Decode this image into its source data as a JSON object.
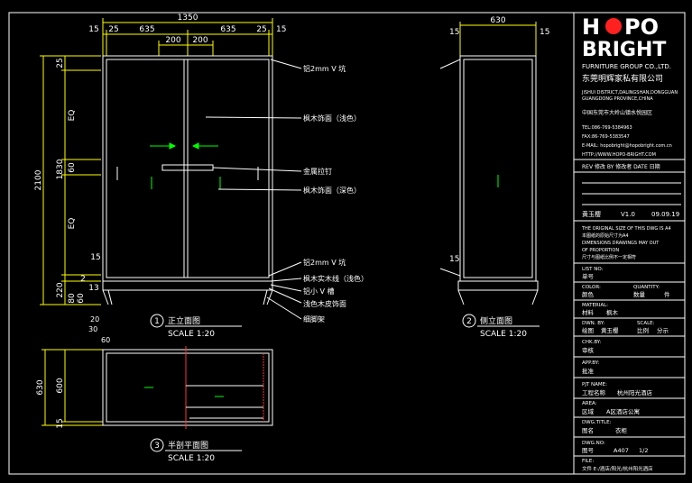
{
  "colors": {
    "background": "#000000",
    "line": "#ffffff",
    "dimension": "#ffff00",
    "accent": "#00ff00",
    "section": "#ff3333",
    "logo_dot": "#ff2020"
  },
  "front": {
    "dims": {
      "total": "1350",
      "w15": "15",
      "w25": "25",
      "w635": "635",
      "w200a": "200",
      "w200b": "200",
      "h2100": "2100",
      "h1830": "1830",
      "h25": "25",
      "eq1": "EQ",
      "eq2": "EQ",
      "h60": "60",
      "h15a": "15",
      "h13": "13",
      "h2": "2",
      "h220": "220",
      "h80": "80",
      "h60b": "60",
      "f20": "20",
      "f30": "30",
      "f60": "60"
    },
    "callouts": [
      "铝2mm V 坑",
      "枫木饰面（浅色）",
      "金属拉钉",
      "枫木饰面（深色）",
      "铝2mm V 坑",
      "枫木实木线（浅色）",
      "铝小 V 槽",
      "浅色木皮饰面",
      "细脚架"
    ],
    "title": "正立面图",
    "scale": "SCALE 1:20",
    "number": "1"
  },
  "side": {
    "width": "630",
    "w15a": "15",
    "w15b": "15",
    "h15": "15",
    "title": "侧立面图",
    "scale": "SCALE 1:20",
    "number": "2"
  },
  "plan": {
    "h630": "630",
    "h600": "600",
    "h15": "15",
    "title": "半剖平面图",
    "scale": "SCALE 1:20",
    "number": "3"
  },
  "panel": {
    "logo_top_left": "H",
    "logo_top_right": "PO",
    "logo_bottom": "BRIGHT",
    "group": "FURNITURE GROUP CO.,LTD.",
    "company_cn": "东莞明辉家私有限公司",
    "address_en_1": "JISHUI DISTRICT,DALINGSHAN,DONGGUAN",
    "address_en_2": "GUANGDONG PROVINCE,CHINA",
    "address_cn": "中国东莞市大岭山镇水悦园区",
    "tel": "TEL:086-769-5384963",
    "fax": "FAX:86-769-5383547",
    "email": "E-MAIL: hopobright@hopobright.com.cn",
    "http": "HTTP://WWW.HOPO-BRIGHT.COM",
    "rev_header": "REV 修改    BY 修改者    DATE 日期",
    "rev_person": "黄玉樱",
    "rev_version": "V1.0",
    "rev_date": "09.09.19",
    "orig_1": "THE ORIGINAL SIZE OF THIS DWG IS A4",
    "orig_2": "本图纸的原始尺寸为A4",
    "orig_3": "DIMENSIONS DRAWINGS MAY OUT",
    "orig_4": "OF PROPORTION",
    "orig_5": "尺寸与图纸比例不一定相符",
    "list_no_label": "LIST NO:",
    "list_no_cn": "单号",
    "color_label": "COLOR:",
    "quantity_label": "QUANTITY:",
    "color_cn": "颜色",
    "qty_cn": "数量",
    "qty_unit": "件",
    "material_label": "MATERIAL:",
    "material_cn": "材料",
    "material_value": "枫木",
    "dwn_label": "DWN. BY:",
    "scale_label": "SCALE:",
    "dwn_cn": "绘图",
    "dwn_value": "黄玉樱",
    "scale_cn": "比例",
    "scale_value": "分示",
    "chkby_label": "CHK.BY:",
    "chkby_cn": "审核",
    "appby_label": "APP.BY:",
    "appby_cn": "批准",
    "pjt_label": "PJT NAME:",
    "pjt_cn": "工程名称",
    "pjt_value": "杭州阳光酒店",
    "area_label": "AREA:",
    "area_cn": "区域",
    "area_value": "A区酒店公寓",
    "dwg_title_label": "DWG.TITLE:",
    "dwg_title_cn": "图名",
    "dwg_title_value": "衣柜",
    "dwg_no_label": "DWG.NO:",
    "dwg_no_cn": "图号",
    "dwg_no_value": "A407",
    "dwg_page": "1/2",
    "file_label": "FILE:",
    "file_value": "文件 E:/酒店/阳光/杭州阳光酒店"
  }
}
